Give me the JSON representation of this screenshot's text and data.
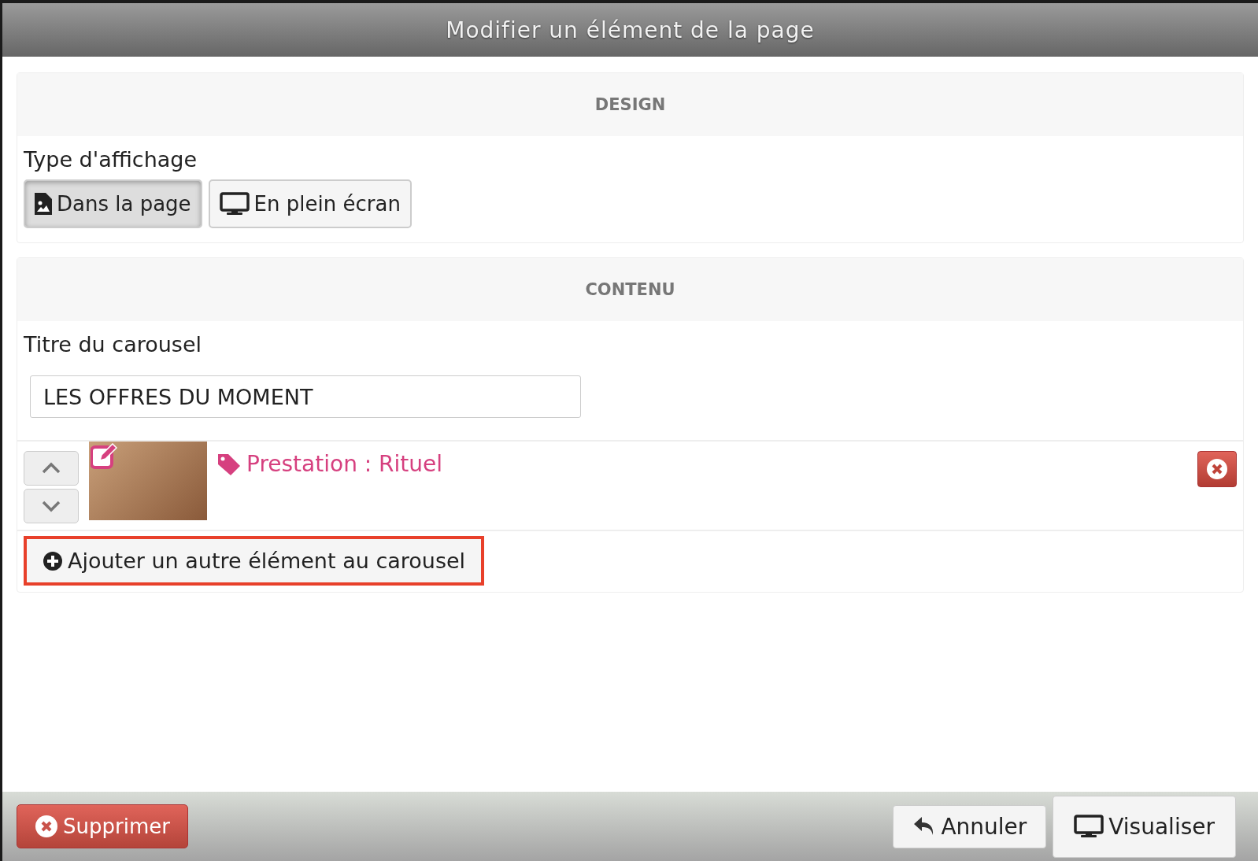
{
  "window": {
    "title": "Modifier un élément de la page"
  },
  "design": {
    "header": "DESIGN",
    "label": "Type d'affichage",
    "options": [
      {
        "kind": "page",
        "label": "Dans la page",
        "selected": true
      },
      {
        "kind": "screen",
        "label": "En plein écran",
        "selected": false
      }
    ]
  },
  "content": {
    "header": "CONTENU",
    "title_label": "Titre du carousel",
    "title_value": "LES OFFRES DU MOMENT",
    "items": [
      {
        "label": "Prestation : Rituel"
      }
    ],
    "add_button": {
      "label": "Ajouter un autre élément au carousel",
      "highlighted": true
    }
  },
  "footer": {
    "delete": "Supprimer",
    "cancel": "Annuler",
    "preview": "Visualiser"
  }
}
